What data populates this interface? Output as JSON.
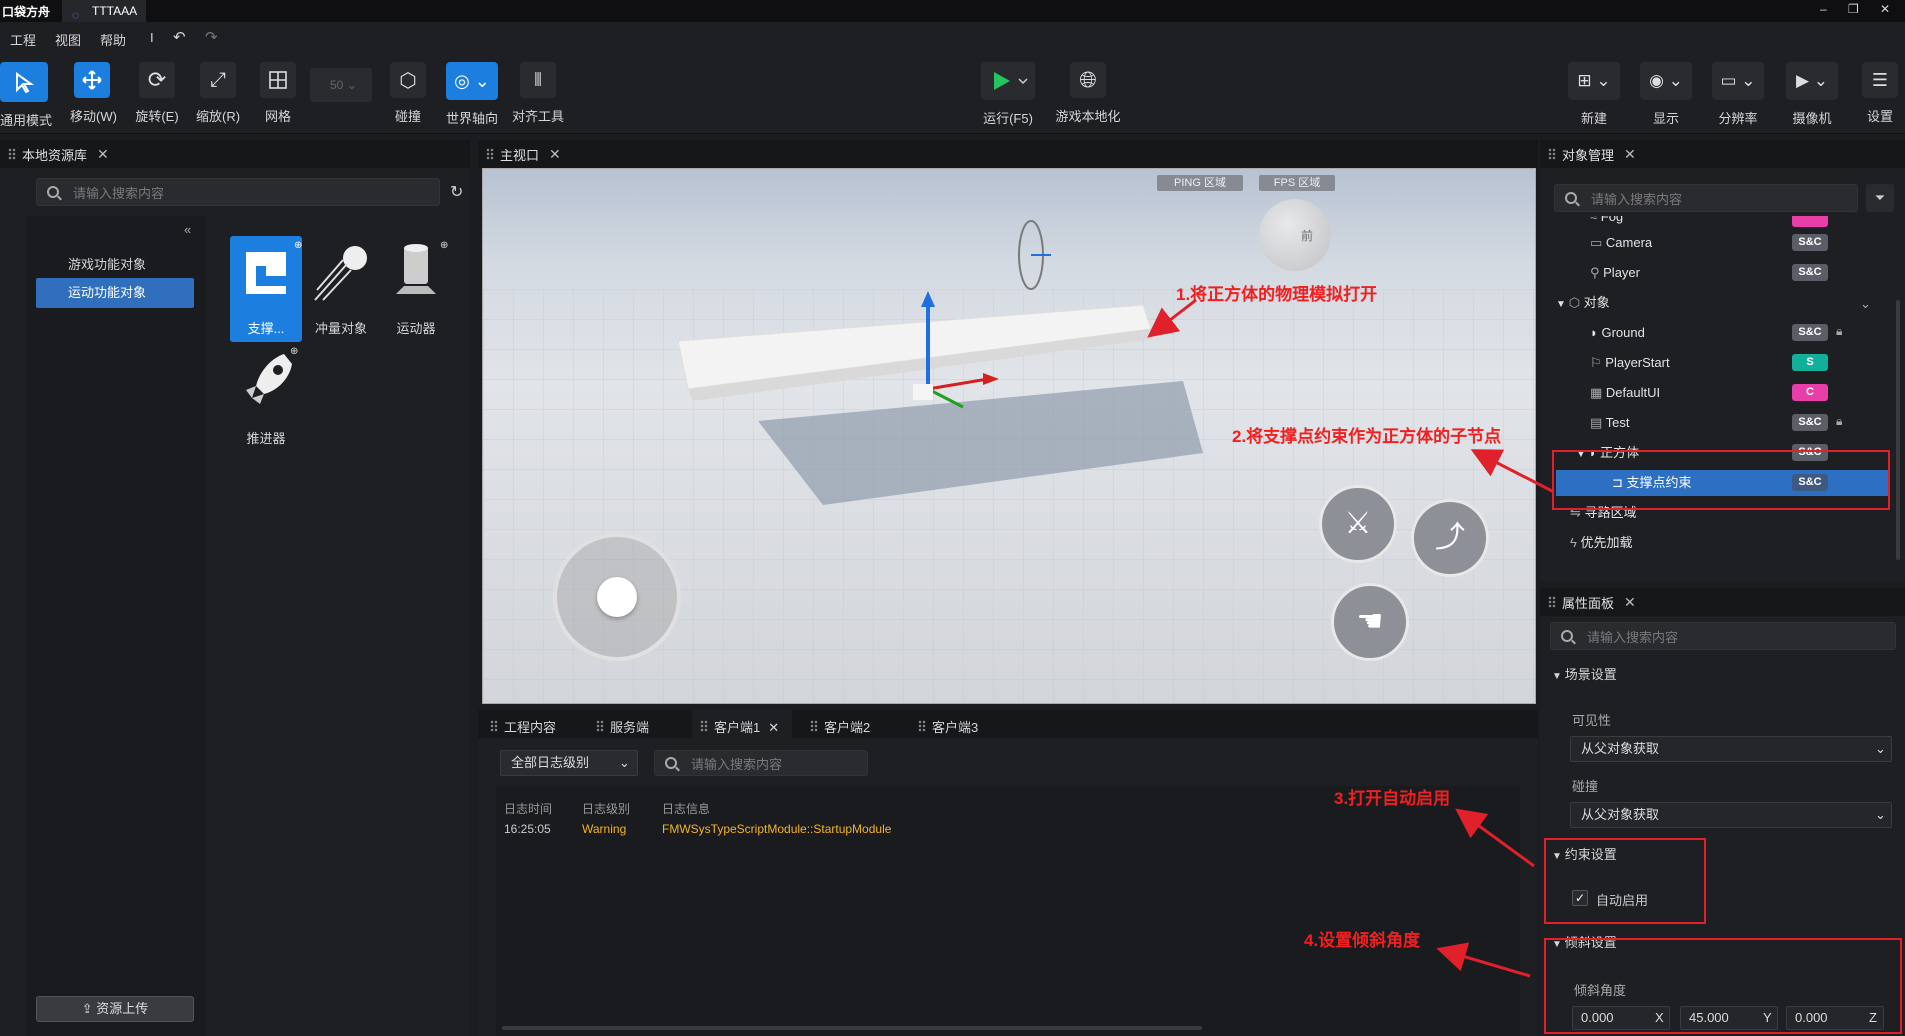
{
  "app": {
    "logo": "口袋方舟",
    "tab_title": "TTTAAA"
  },
  "window": {
    "minimize": "–",
    "maximize": "❐",
    "close": "✕"
  },
  "menu": {
    "items": [
      "工程",
      "视图",
      "帮助",
      "I"
    ]
  },
  "toolbar": {
    "general_mode": "通用模式",
    "move": "移动(W)",
    "rotate": "旋转(E)",
    "scale": "缩放(R)",
    "grid": "网格",
    "grid_value": "50",
    "collision": "碰撞",
    "world_axis": "世界轴向",
    "align_tool": "对齐工具",
    "run": "运行(F5)",
    "localize": "游戏本地化",
    "new": "新建",
    "display": "显示",
    "resolution": "分辨率",
    "camera": "摄像机",
    "settings": "设置"
  },
  "left_panel": {
    "title": "本地资源库",
    "search_placeholder": "请输入搜索内容",
    "categories": [
      "游戏功能对象",
      "运动功能对象"
    ],
    "assets": [
      "支撑...",
      "冲量对象",
      "运动器",
      "推进器"
    ],
    "upload": "资源上传"
  },
  "viewport": {
    "title": "主视口",
    "ping": "PING 区域",
    "fps": "FPS 区域",
    "cube_front": "前"
  },
  "console": {
    "tabs": [
      "工程内容",
      "服务端",
      "客户端1",
      "客户端2",
      "客户端3"
    ],
    "level_filter": "全部日志级别",
    "search_placeholder": "请输入搜索内容",
    "headers": [
      "日志时间",
      "日志级别",
      "日志信息"
    ],
    "rows": [
      {
        "time": "16:25:05",
        "level": "Warning",
        "message": "FMWSysTypeScriptModule::StartupModule"
      }
    ]
  },
  "objects": {
    "title": "对象管理",
    "search_placeholder": "请输入搜索内容",
    "items": [
      {
        "label": "Fog",
        "badge": ""
      },
      {
        "label": "Camera",
        "badge": "S&C"
      },
      {
        "label": "Player",
        "badge": "S&C"
      },
      {
        "label": "对象",
        "badge": ""
      },
      {
        "label": "Ground",
        "badge": "S&C"
      },
      {
        "label": "PlayerStart",
        "badge": "S"
      },
      {
        "label": "DefaultUI",
        "badge": "C"
      },
      {
        "label": "Test",
        "badge": "S&C"
      },
      {
        "label": "正方体",
        "badge": "S&C"
      },
      {
        "label": "支撑点约束",
        "badge": "S&C"
      },
      {
        "label": "寻路区域",
        "badge": ""
      },
      {
        "label": "优先加载",
        "badge": ""
      }
    ]
  },
  "properties": {
    "title": "属性面板",
    "search_placeholder": "请输入搜索内容",
    "scene_settings": "场景设置",
    "visibility": "可见性",
    "visibility_value": "从父对象获取",
    "collision": "碰撞",
    "collision_value": "从父对象获取",
    "constraint_settings": "约束设置",
    "auto_enable": "自动启用",
    "tilt_settings": "倾斜设置",
    "tilt_angle": "倾斜角度",
    "tilt": {
      "x": "0.000",
      "y": "45.000",
      "z": "0.000",
      "x_label": "X",
      "y_label": "Y",
      "z_label": "Z"
    }
  },
  "annotations": {
    "a1": "1.将正方体的物理模拟打开",
    "a2": "2.将支撑点约束作为正方体的子节点",
    "a3": "3.打开自动启用",
    "a4": "4.设置倾斜角度"
  },
  "colors": {
    "accent": "#1c7fe0",
    "badge_sc": "#5b5e66",
    "badge_s": "#12b09a",
    "badge_c": "#e83ea8",
    "annotation": "#e0202a"
  }
}
